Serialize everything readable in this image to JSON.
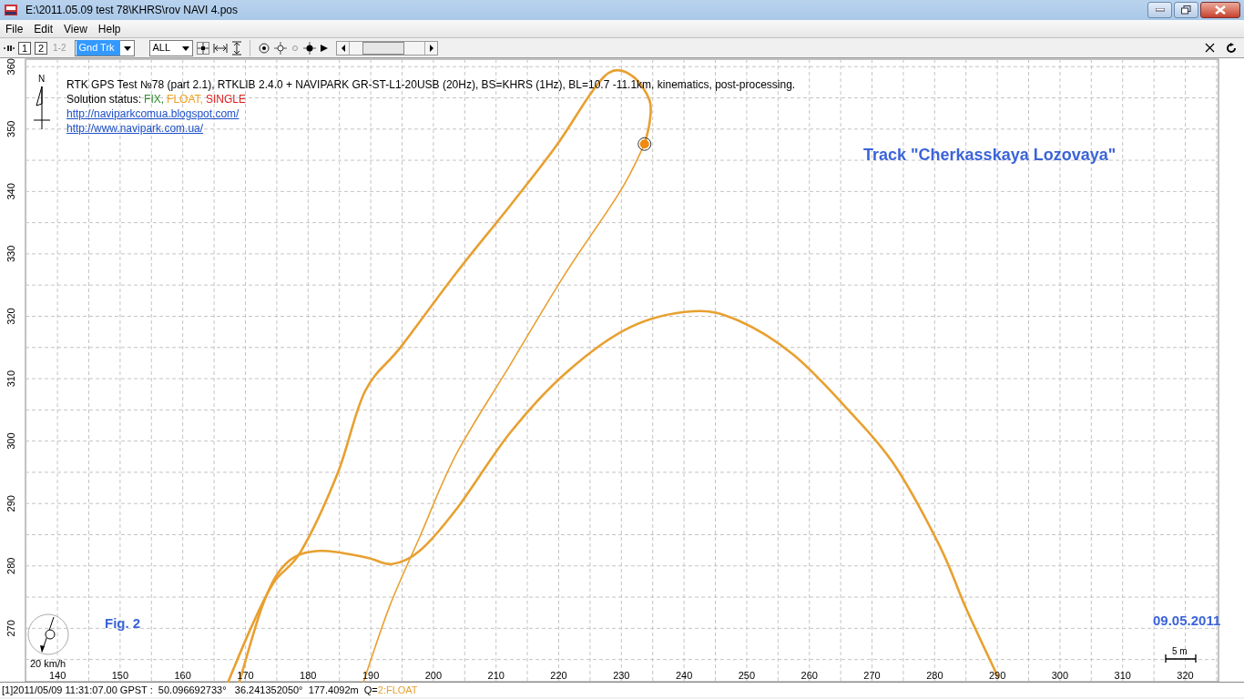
{
  "window": {
    "title": "E:\\2011.05.09 test 78\\KHRS\\rov NAVI 4.pos"
  },
  "menu": [
    "File",
    "Edit",
    "View",
    "Help"
  ],
  "toolbar": {
    "frame_buttons": [
      {
        "label": "1",
        "disabled": false
      },
      {
        "label": "2",
        "disabled": false
      },
      {
        "label": "1-2",
        "disabled": true
      }
    ],
    "plot_type": "Gnd Trk",
    "quality_filter": "ALL"
  },
  "plot": {
    "info": {
      "title": "RTK GPS Test №78 (part 2.1), RTKLIB 2.4.0 + NAVIPARK GR-ST-L1-20USB (20Hz), BS=KHRS (1Hz), BL=10.7 -11.1km, kinematics, post-processing.",
      "status_label": "Solution status:",
      "statuses": [
        {
          "text": "FIX,",
          "color": "#2e8b2e"
        },
        {
          "text": "FLOAT,",
          "color": "#f0a020"
        },
        {
          "text": "SINGLE",
          "color": "#e02020"
        }
      ],
      "links": [
        "http://naviparkcomua.blogspot.com/",
        "http://www.navipark.com.ua/"
      ]
    },
    "track_title": "Track \"Cherkasskaya Lozovaya\"",
    "figure_label": "Fig. 2",
    "date": "09.05.2011",
    "north_label": "N",
    "speed_label": "20 km/h",
    "scale_label": "5 m",
    "chart_data": {
      "type": "line",
      "grid": true,
      "xlim": [
        134.9,
        325.3
      ],
      "ylim": [
        261.3,
        361.2
      ],
      "xticks": [
        140,
        150,
        160,
        170,
        180,
        190,
        200,
        210,
        220,
        230,
        240,
        250,
        260,
        270,
        280,
        290,
        300,
        310,
        320
      ],
      "yticks": [
        270,
        280,
        290,
        300,
        310,
        320,
        330,
        340,
        350,
        360
      ],
      "series": [
        {
          "color": "#e8a030",
          "x": [
            167.2,
            170.9,
            174.5,
            178.9,
            184.7,
            189.1,
            194.9,
            203.6,
            212.3,
            219.6,
            225.4,
            228.6,
            232.0,
            234.5,
            234.5,
            233.7
          ],
          "values": [
            261.3,
            270.1,
            277.3,
            282.4,
            294.8,
            308.0,
            315.2,
            326.9,
            337.8,
            347.3,
            356.1,
            359.3,
            358.3,
            354.6,
            351.0,
            347.6
          ]
        },
        {
          "color": "#e8a030",
          "x": [
            233.7,
            229.8,
            221.1,
            212.3,
            203.6,
            197.8,
            193.0,
            188.8
          ],
          "values": [
            347.6,
            340.0,
            326.9,
            312.3,
            297.8,
            284.6,
            273.5,
            261.3
          ]
        },
        {
          "color": "#e8a030",
          "x": [
            169.0,
            173.0,
            176.7,
            181.8,
            189.1,
            193.4,
            197.8,
            203.6,
            212.3,
            221.1,
            231.3,
            241.5,
            248.7,
            257.5,
            266.2,
            273.5,
            280.8,
            285.1,
            290.2
          ],
          "values": [
            261.3,
            274.4,
            280.6,
            282.4,
            281.4,
            280.3,
            282.4,
            289.0,
            301.4,
            310.9,
            318.2,
            320.8,
            319.3,
            313.8,
            305.0,
            296.3,
            283.2,
            273.0,
            262.0
          ]
        }
      ]
    }
  },
  "status_bar": {
    "text": "[1]2011/05/09 11:31:07.00 GPST :  50.096692733°   36.241352050°  177.4092m  Q=",
    "quality": {
      "text": "2:FLOAT",
      "color": "#e8a030"
    }
  }
}
